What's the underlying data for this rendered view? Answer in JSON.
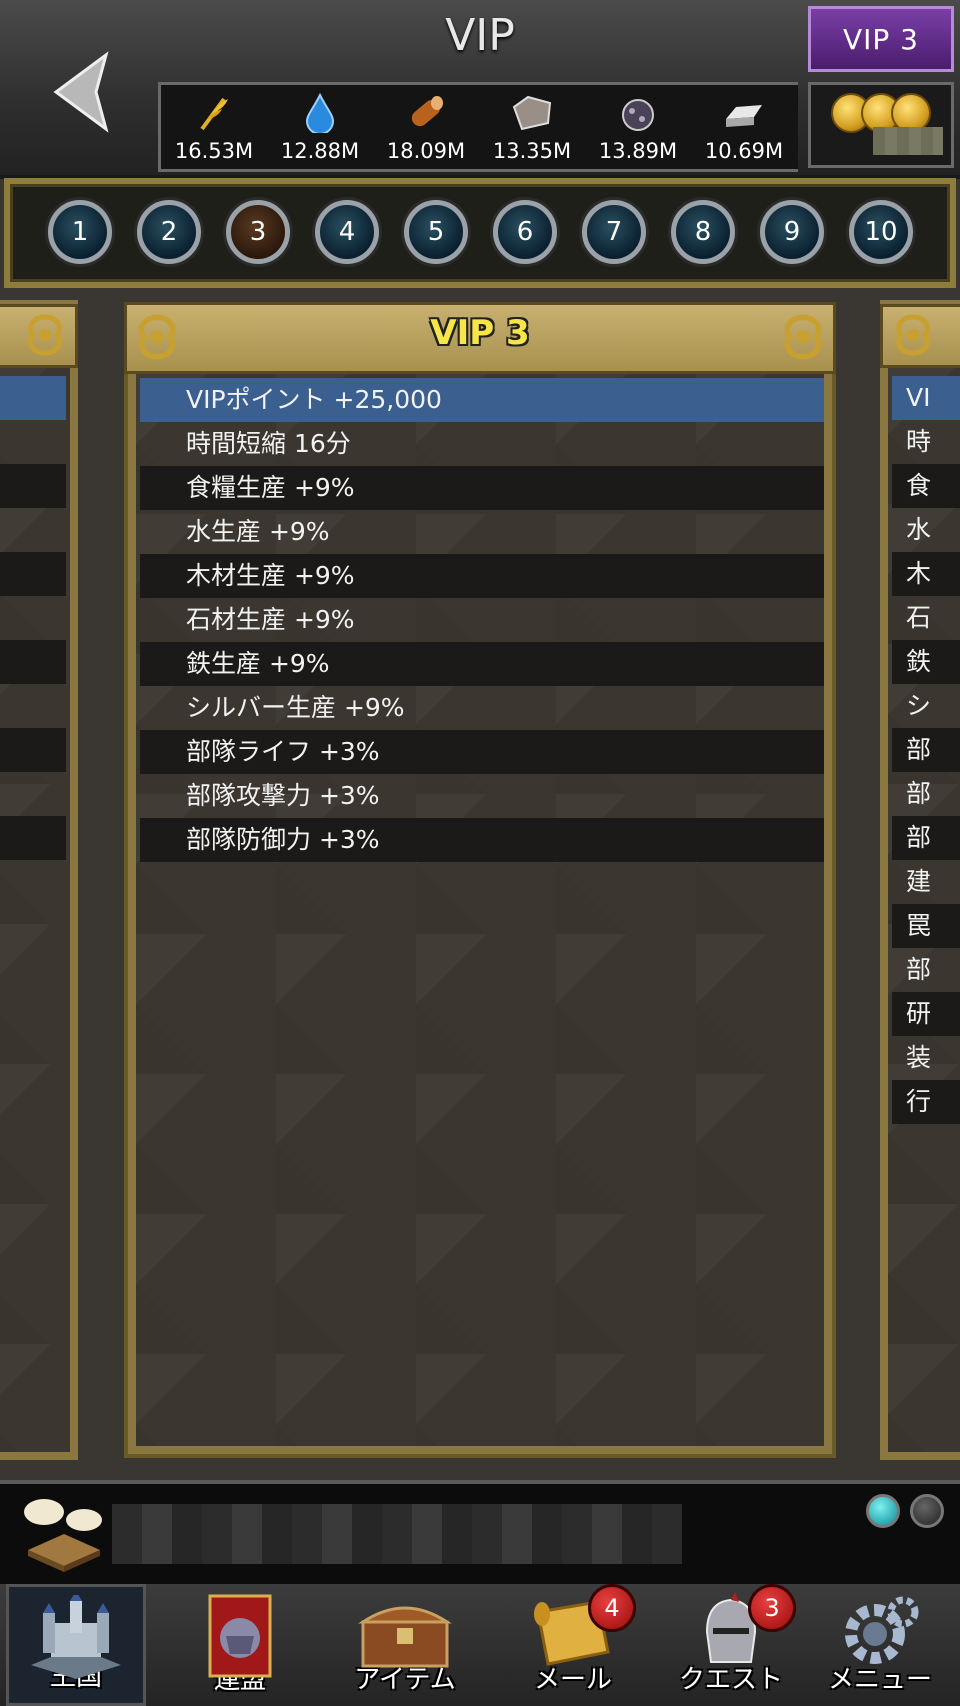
{
  "header": {
    "title": "VIP",
    "vip_badge": "VIP  3",
    "resources": [
      {
        "icon": "wheat-icon",
        "value": "16.53M"
      },
      {
        "icon": "water-drop-icon",
        "value": "12.88M"
      },
      {
        "icon": "log-icon",
        "value": "18.09M"
      },
      {
        "icon": "stone-icon",
        "value": "13.35M"
      },
      {
        "icon": "iron-ore-icon",
        "value": "13.89M"
      },
      {
        "icon": "silver-ingot-icon",
        "value": "10.69M"
      }
    ]
  },
  "level_tabs": [
    "1",
    "2",
    "3",
    "4",
    "5",
    "6",
    "7",
    "8",
    "9",
    "10"
  ],
  "selected_level": "3",
  "panel": {
    "title": "VIP 3",
    "rows": [
      "VIPポイント +25,000",
      "時間短縮 16分",
      "食糧生産 +9%",
      "水生産 +9%",
      "木材生産 +9%",
      "石材生産 +9%",
      "鉄生産 +9%",
      "シルバー生産 +9%",
      "部隊ライフ +3%",
      "部隊攻撃力 +3%",
      "部隊防御力 +3%"
    ]
  },
  "right_peek_rows": [
    "VI",
    "時",
    "食",
    "水",
    "木",
    "石",
    "鉄",
    "シ",
    "部",
    "部",
    "部",
    "建",
    "罠",
    "部",
    "研",
    "装",
    "行"
  ],
  "bottom_nav": {
    "kingdom": "王国",
    "alliance": "連盟",
    "items": "アイテム",
    "mail": "メール",
    "mail_badge": "4",
    "quest": "クエスト",
    "quest_badge": "3",
    "menu": "メニュー"
  },
  "colors": {
    "selected_row": "#3b5f8e",
    "panel_title": "#f7e64a",
    "frame_gold": "#8a7840",
    "badge_red": "#c81e1e"
  }
}
